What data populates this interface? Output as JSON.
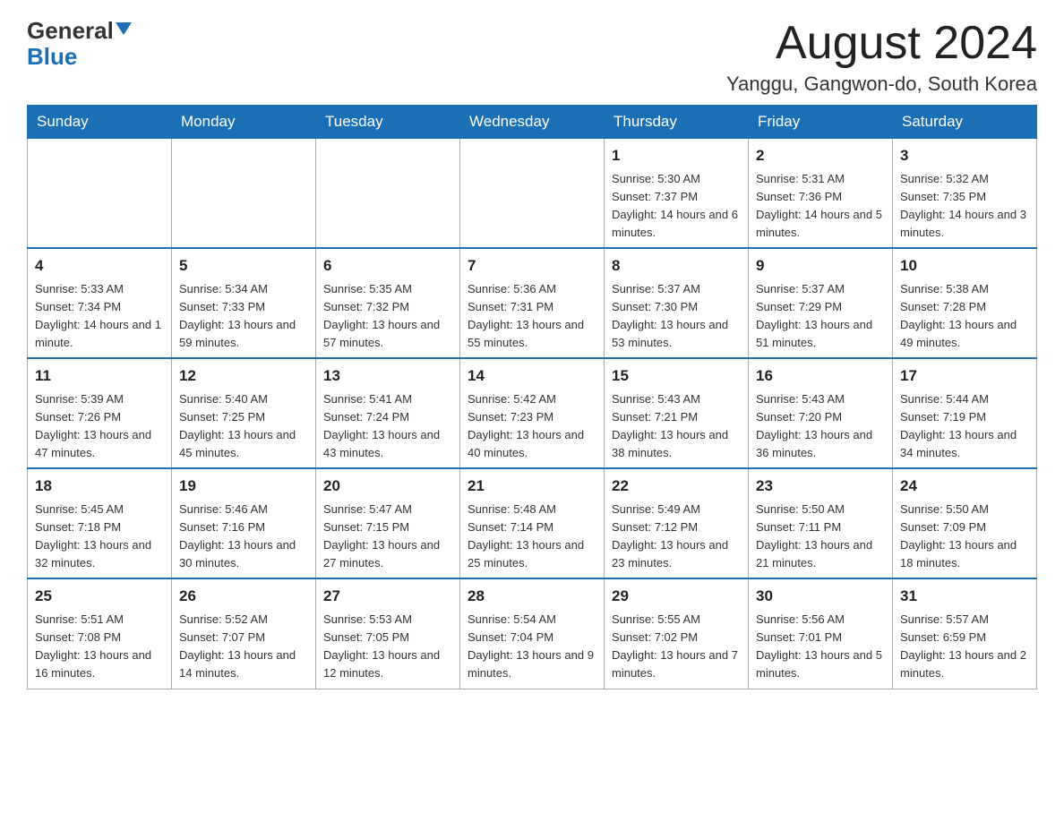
{
  "header": {
    "logo_general": "General",
    "logo_blue": "Blue",
    "main_title": "August 2024",
    "subtitle": "Yanggu, Gangwon-do, South Korea"
  },
  "weekdays": [
    "Sunday",
    "Monday",
    "Tuesday",
    "Wednesday",
    "Thursday",
    "Friday",
    "Saturday"
  ],
  "weeks": [
    [
      {
        "day": "",
        "info": ""
      },
      {
        "day": "",
        "info": ""
      },
      {
        "day": "",
        "info": ""
      },
      {
        "day": "",
        "info": ""
      },
      {
        "day": "1",
        "info": "Sunrise: 5:30 AM\nSunset: 7:37 PM\nDaylight: 14 hours\nand 6 minutes."
      },
      {
        "day": "2",
        "info": "Sunrise: 5:31 AM\nSunset: 7:36 PM\nDaylight: 14 hours\nand 5 minutes."
      },
      {
        "day": "3",
        "info": "Sunrise: 5:32 AM\nSunset: 7:35 PM\nDaylight: 14 hours\nand 3 minutes."
      }
    ],
    [
      {
        "day": "4",
        "info": "Sunrise: 5:33 AM\nSunset: 7:34 PM\nDaylight: 14 hours\nand 1 minute."
      },
      {
        "day": "5",
        "info": "Sunrise: 5:34 AM\nSunset: 7:33 PM\nDaylight: 13 hours\nand 59 minutes."
      },
      {
        "day": "6",
        "info": "Sunrise: 5:35 AM\nSunset: 7:32 PM\nDaylight: 13 hours\nand 57 minutes."
      },
      {
        "day": "7",
        "info": "Sunrise: 5:36 AM\nSunset: 7:31 PM\nDaylight: 13 hours\nand 55 minutes."
      },
      {
        "day": "8",
        "info": "Sunrise: 5:37 AM\nSunset: 7:30 PM\nDaylight: 13 hours\nand 53 minutes."
      },
      {
        "day": "9",
        "info": "Sunrise: 5:37 AM\nSunset: 7:29 PM\nDaylight: 13 hours\nand 51 minutes."
      },
      {
        "day": "10",
        "info": "Sunrise: 5:38 AM\nSunset: 7:28 PM\nDaylight: 13 hours\nand 49 minutes."
      }
    ],
    [
      {
        "day": "11",
        "info": "Sunrise: 5:39 AM\nSunset: 7:26 PM\nDaylight: 13 hours\nand 47 minutes."
      },
      {
        "day": "12",
        "info": "Sunrise: 5:40 AM\nSunset: 7:25 PM\nDaylight: 13 hours\nand 45 minutes."
      },
      {
        "day": "13",
        "info": "Sunrise: 5:41 AM\nSunset: 7:24 PM\nDaylight: 13 hours\nand 43 minutes."
      },
      {
        "day": "14",
        "info": "Sunrise: 5:42 AM\nSunset: 7:23 PM\nDaylight: 13 hours\nand 40 minutes."
      },
      {
        "day": "15",
        "info": "Sunrise: 5:43 AM\nSunset: 7:21 PM\nDaylight: 13 hours\nand 38 minutes."
      },
      {
        "day": "16",
        "info": "Sunrise: 5:43 AM\nSunset: 7:20 PM\nDaylight: 13 hours\nand 36 minutes."
      },
      {
        "day": "17",
        "info": "Sunrise: 5:44 AM\nSunset: 7:19 PM\nDaylight: 13 hours\nand 34 minutes."
      }
    ],
    [
      {
        "day": "18",
        "info": "Sunrise: 5:45 AM\nSunset: 7:18 PM\nDaylight: 13 hours\nand 32 minutes."
      },
      {
        "day": "19",
        "info": "Sunrise: 5:46 AM\nSunset: 7:16 PM\nDaylight: 13 hours\nand 30 minutes."
      },
      {
        "day": "20",
        "info": "Sunrise: 5:47 AM\nSunset: 7:15 PM\nDaylight: 13 hours\nand 27 minutes."
      },
      {
        "day": "21",
        "info": "Sunrise: 5:48 AM\nSunset: 7:14 PM\nDaylight: 13 hours\nand 25 minutes."
      },
      {
        "day": "22",
        "info": "Sunrise: 5:49 AM\nSunset: 7:12 PM\nDaylight: 13 hours\nand 23 minutes."
      },
      {
        "day": "23",
        "info": "Sunrise: 5:50 AM\nSunset: 7:11 PM\nDaylight: 13 hours\nand 21 minutes."
      },
      {
        "day": "24",
        "info": "Sunrise: 5:50 AM\nSunset: 7:09 PM\nDaylight: 13 hours\nand 18 minutes."
      }
    ],
    [
      {
        "day": "25",
        "info": "Sunrise: 5:51 AM\nSunset: 7:08 PM\nDaylight: 13 hours\nand 16 minutes."
      },
      {
        "day": "26",
        "info": "Sunrise: 5:52 AM\nSunset: 7:07 PM\nDaylight: 13 hours\nand 14 minutes."
      },
      {
        "day": "27",
        "info": "Sunrise: 5:53 AM\nSunset: 7:05 PM\nDaylight: 13 hours\nand 12 minutes."
      },
      {
        "day": "28",
        "info": "Sunrise: 5:54 AM\nSunset: 7:04 PM\nDaylight: 13 hours\nand 9 minutes."
      },
      {
        "day": "29",
        "info": "Sunrise: 5:55 AM\nSunset: 7:02 PM\nDaylight: 13 hours\nand 7 minutes."
      },
      {
        "day": "30",
        "info": "Sunrise: 5:56 AM\nSunset: 7:01 PM\nDaylight: 13 hours\nand 5 minutes."
      },
      {
        "day": "31",
        "info": "Sunrise: 5:57 AM\nSunset: 6:59 PM\nDaylight: 13 hours\nand 2 minutes."
      }
    ]
  ]
}
